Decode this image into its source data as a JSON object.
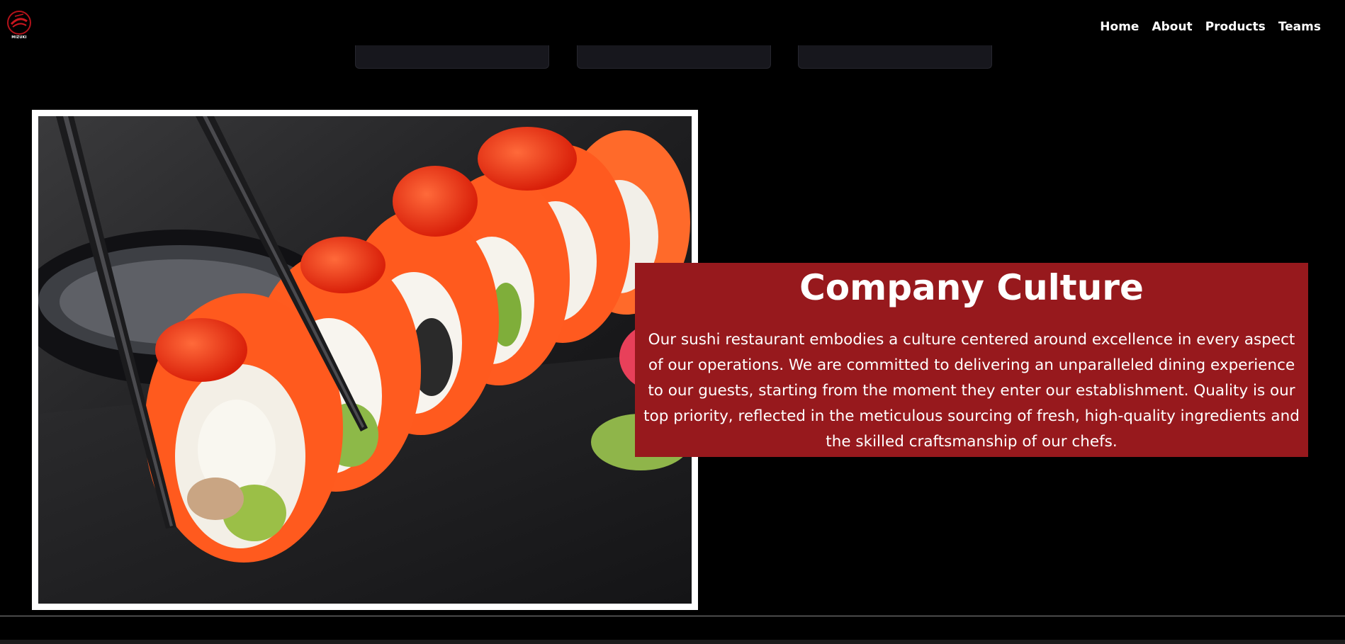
{
  "header": {
    "logo_icon": "sushi-logo-icon",
    "logo_text": "MIZUKI",
    "nav": [
      {
        "label": "Home"
      },
      {
        "label": "About"
      },
      {
        "label": "Products"
      },
      {
        "label": "Teams"
      }
    ]
  },
  "culture": {
    "title": "Company Culture",
    "body": "Our sushi restaurant embodies a culture centered around excellence in every aspect of our operations. We are committed to delivering an unparalleled dining experience to our guests, starting from the moment they enter our establishment. Quality is our top priority, reflected in the meticulous sourcing of fresh, high-quality ingredients and the skilled craftsmanship of our chefs."
  },
  "colors": {
    "background": "#000000",
    "accent": "#97191d",
    "text": "#ffffff"
  }
}
